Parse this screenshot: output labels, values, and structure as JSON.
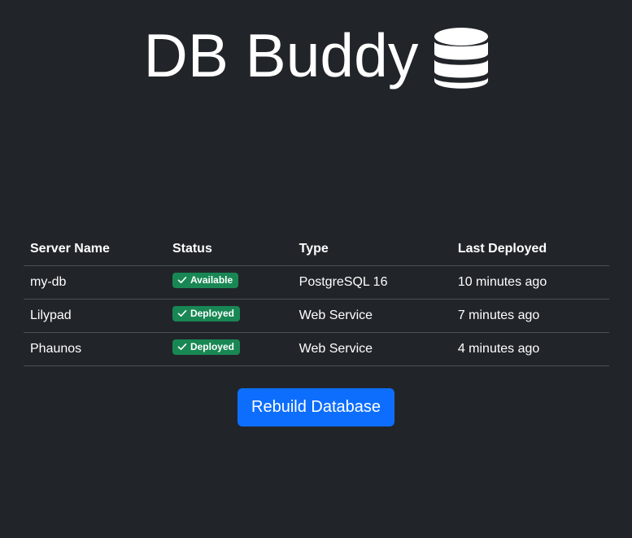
{
  "header": {
    "title": "DB Buddy",
    "icon": "database-icon"
  },
  "table": {
    "columns": [
      "Server Name",
      "Status",
      "Type",
      "Last Deployed"
    ],
    "rows": [
      {
        "name": "my-db",
        "status": "Available",
        "type": "PostgreSQL 16",
        "last_deployed": "10 minutes ago"
      },
      {
        "name": "Lilypad",
        "status": "Deployed",
        "type": "Web Service",
        "last_deployed": "7 minutes ago"
      },
      {
        "name": "Phaunos",
        "status": "Deployed",
        "type": "Web Service",
        "last_deployed": "4 minutes ago"
      }
    ]
  },
  "actions": {
    "rebuild_label": "Rebuild Database"
  },
  "colors": {
    "background": "#212529",
    "badge_success": "#198754",
    "primary_button": "#0d6efd"
  }
}
